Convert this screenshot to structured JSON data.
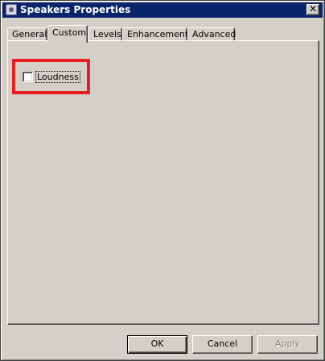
{
  "window": {
    "title": "Speakers Properties",
    "close_symbol": "✕"
  },
  "tabs": [
    {
      "label": "General",
      "active": false
    },
    {
      "label": "Custom",
      "active": true
    },
    {
      "label": "Levels",
      "active": false
    },
    {
      "label": "Enhancements",
      "active": false
    },
    {
      "label": "Advanced",
      "active": false
    }
  ],
  "custom_panel": {
    "loudness": {
      "label": "Loudness",
      "checked": false
    }
  },
  "buttons": {
    "ok": "OK",
    "cancel": "Cancel",
    "apply": "Apply",
    "apply_enabled": false
  },
  "colors": {
    "title_bar": "#0a246a",
    "annotation_highlight": "#ec1c24",
    "face": "#d4d0c8"
  }
}
